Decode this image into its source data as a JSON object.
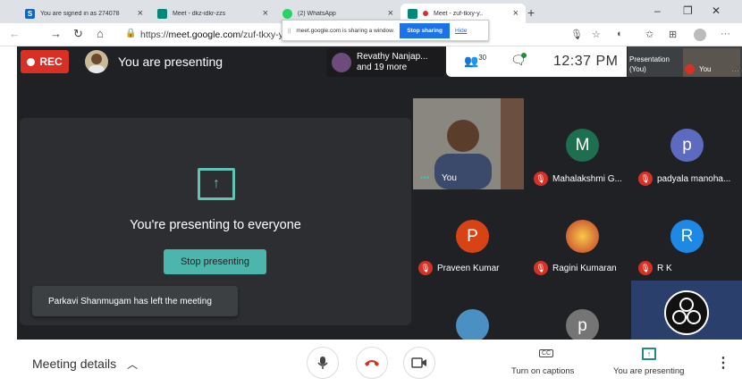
{
  "browser": {
    "tabs": [
      {
        "title": "You are signed in as 274078",
        "favicon_color": "#1565c0",
        "favicon_letter": "S"
      },
      {
        "title": "Meet - dkz-idkr-zzs",
        "favicon_color": "#00897b"
      },
      {
        "title": "(2) WhatsApp",
        "favicon_color": "#25d366"
      },
      {
        "title": "Meet - zuf-tkxy-y..",
        "favicon_color": "#00897b"
      }
    ],
    "url_prefix": "https://",
    "url_host": "meet.google.com",
    "url_path": "/zuf-tkxy-yo",
    "share_popup": {
      "message": "meet.google.com is sharing a window.",
      "stop_label": "Stop sharing",
      "hide_label": "Hide"
    }
  },
  "meet": {
    "rec_label": "REC",
    "presenting_label": "You are presenting",
    "notification": {
      "line1": "Revathy Nanjap...",
      "line2": "and 19 more"
    },
    "people_count": "30",
    "clock": "12:37 PM",
    "presentation_thumb": {
      "line1": "Presentation",
      "line2": "(You)",
      "you_label": "You"
    },
    "presentation_panel": {
      "message": "You're presenting to everyone",
      "stop_label": "Stop presenting"
    },
    "toast": "Parkavi Shanmugam has left the meeting",
    "tiles": [
      {
        "name": "You",
        "muted": false
      },
      {
        "name": "Mahalakshmi G...",
        "initial": "M",
        "color": "#1e6e50",
        "muted": true
      },
      {
        "name": "padyala manoha...",
        "initial": "p",
        "color": "#5c6bc0",
        "muted": true
      },
      {
        "name": "Praveen Kumar",
        "initial": "P",
        "color": "#d84315",
        "muted": true
      },
      {
        "name": "Ragini Kumaran",
        "muted": true
      },
      {
        "name": "R K",
        "initial": "R",
        "color": "#1e88e5",
        "muted": true
      },
      {
        "initial": "p",
        "color": "#757575"
      }
    ]
  },
  "bottom": {
    "meeting_details": "Meeting details",
    "captions_label": "Turn on captions",
    "captions_icon": "CC",
    "presenting_label": "You are presenting"
  }
}
